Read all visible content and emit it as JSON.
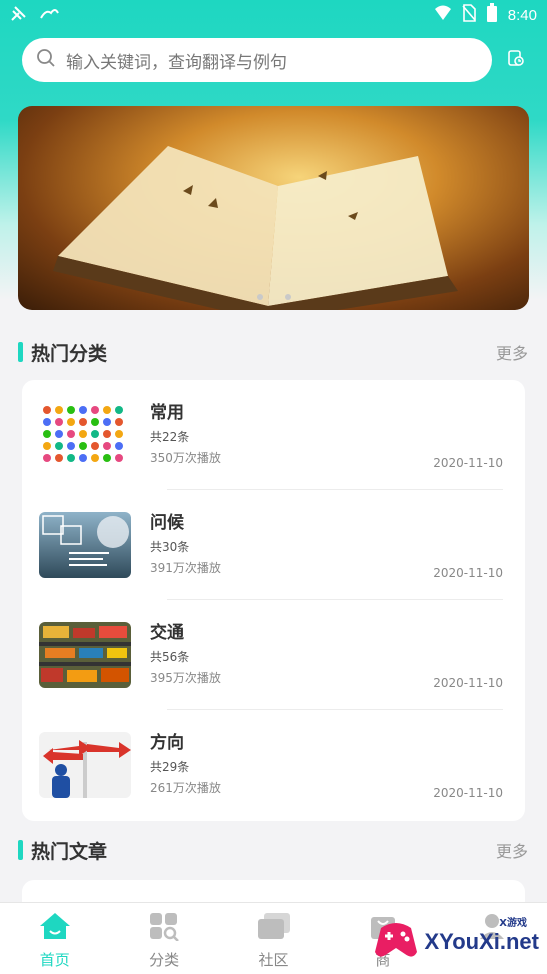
{
  "status_bar": {
    "time": "8:40"
  },
  "search": {
    "placeholder": "输入关键词，查询翻译与例句"
  },
  "banner": {
    "page_count": 2,
    "active_page": 1
  },
  "hot_categories": {
    "title": "热门分类",
    "more_label": "更多",
    "items": [
      {
        "title": "常用",
        "count": "共22条",
        "plays": "350万次播放",
        "date": "2020-11-10"
      },
      {
        "title": "问候",
        "count": "共30条",
        "plays": "391万次播放",
        "date": "2020-11-10"
      },
      {
        "title": "交通",
        "count": "共56条",
        "plays": "395万次播放",
        "date": "2020-11-10"
      },
      {
        "title": "方向",
        "count": "共29条",
        "plays": "261万次播放",
        "date": "2020-11-10"
      }
    ]
  },
  "hot_articles": {
    "title": "热门文章",
    "more_label": "更多"
  },
  "tabbar": {
    "tabs": [
      {
        "label": "首页",
        "icon": "home-icon",
        "active": true
      },
      {
        "label": "分类",
        "icon": "category-icon",
        "active": false
      },
      {
        "label": "社区",
        "icon": "community-icon",
        "active": false
      },
      {
        "label": "商",
        "icon": "shop-icon",
        "active": false
      },
      {
        "label": "",
        "icon": "profile-icon",
        "active": false
      }
    ]
  },
  "watermark": {
    "text": "XYouXi.net",
    "small": "X游戏"
  },
  "colors": {
    "accent": "#1ed7c1",
    "background": "#f3f3f5"
  }
}
